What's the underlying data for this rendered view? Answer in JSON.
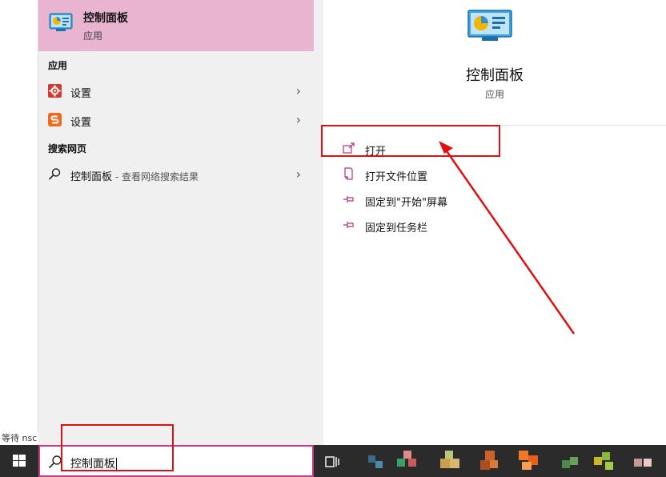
{
  "status": {
    "waiting_text": "等待 nsc"
  },
  "best_match": {
    "title": "控制面板",
    "subtitle": "应用"
  },
  "apps_section": {
    "header": "应用",
    "items": [
      {
        "label": "设置",
        "icon": "gear-icon",
        "accent": "#d13c2f"
      },
      {
        "label": "设置",
        "icon": "sogou-icon",
        "accent": "#f0681a"
      }
    ]
  },
  "web_section": {
    "header": "搜索网页",
    "item": {
      "label": "控制面板",
      "hint": " - 查看网络搜索结果",
      "icon": "search-icon"
    }
  },
  "detail": {
    "title": "控制面板",
    "subtitle": "应用",
    "actions": [
      {
        "label": "打开",
        "icon": "open-icon"
      },
      {
        "label": "打开文件位置",
        "icon": "file-location-icon"
      },
      {
        "label": "固定到\"开始\"屏幕",
        "icon": "pin-icon"
      },
      {
        "label": "固定到任务栏",
        "icon": "pin-icon"
      }
    ]
  },
  "taskbar": {
    "search_value": "控制面板",
    "pinned_icons": [
      "app-icon",
      "app-icon",
      "app-icon",
      "app-icon",
      "app-icon",
      "app-icon",
      "app-icon",
      "app-icon"
    ]
  },
  "colors": {
    "accent_pink": "#e8b4d0",
    "search_border": "#c63a8b",
    "annotation_red": "#e01010",
    "taskbar": "#2b2b2b"
  }
}
